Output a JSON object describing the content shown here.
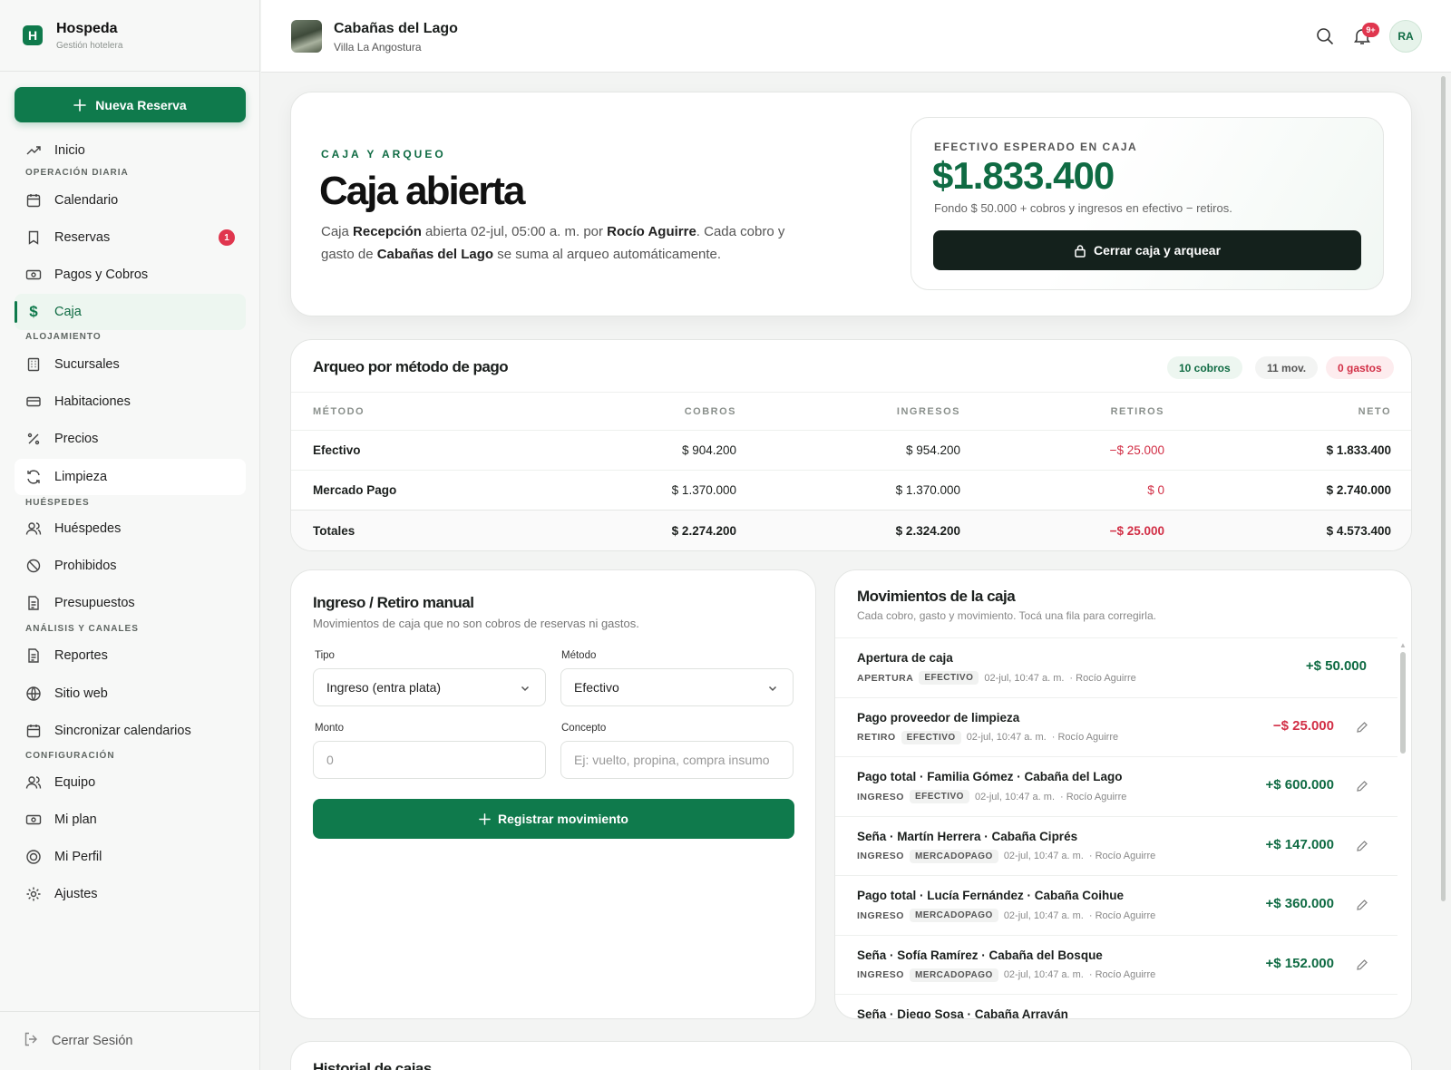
{
  "brand": {
    "name": "Hospeda",
    "subtitle": "Gestión hotelera",
    "logo_letter": "H"
  },
  "sidebar": {
    "new_button": "Nueva Reserva",
    "items": [
      {
        "label": "Inicio",
        "icon": "trend-icon"
      },
      {
        "label": "Calendario",
        "icon": "calendar-icon"
      },
      {
        "label": "Reservas",
        "icon": "bookmark-icon",
        "badge": "1"
      },
      {
        "label": "Pagos y Cobros",
        "icon": "cash-icon"
      },
      {
        "label": "Caja",
        "icon": "dollar-icon",
        "active": true
      },
      {
        "label": "Sucursales",
        "icon": "building-icon"
      },
      {
        "label": "Habitaciones",
        "icon": "bed-icon"
      },
      {
        "label": "Precios",
        "icon": "percent-icon"
      },
      {
        "label": "Limpieza",
        "icon": "refresh-icon"
      },
      {
        "label": "Huéspedes",
        "icon": "users-icon"
      },
      {
        "label": "Prohibidos",
        "icon": "ban-icon"
      },
      {
        "label": "Presupuestos",
        "icon": "file-icon"
      },
      {
        "label": "Reportes",
        "icon": "report-icon"
      },
      {
        "label": "Sitio web",
        "icon": "globe-icon"
      },
      {
        "label": "Sincronizar calendarios",
        "icon": "calendar-sync-icon"
      },
      {
        "label": "Equipo",
        "icon": "team-icon"
      },
      {
        "label": "Mi plan",
        "icon": "plan-icon"
      },
      {
        "label": "Mi Perfil",
        "icon": "profile-icon"
      },
      {
        "label": "Ajustes",
        "icon": "gear-icon"
      }
    ],
    "sections": [
      "OPERACIÓN DIARIA",
      "ALOJAMIENTO",
      "HUÉSPEDES",
      "ANÁLISIS Y CANALES",
      "CONFIGURACIÓN"
    ],
    "logout": "Cerrar Sesión"
  },
  "header": {
    "hotel_name": "Cabañas del Lago",
    "hotel_location": "Villa La Angostura",
    "notifications": "9+",
    "avatar": "RA"
  },
  "hero": {
    "eyebrow": "CAJA Y ARQUEO",
    "title": "Caja abierta",
    "desc_1": "Caja ",
    "desc_station": "Recepción",
    "desc_2": " abierta 02-jul, 05:00 a. m. por ",
    "desc_user": "Rocío Aguirre",
    "desc_3": ". Cada cobro y gasto de ",
    "desc_hotel": "Cabañas del Lago",
    "desc_4": " se suma al arqueo automáticamente.",
    "cash_label": "EFECTIVO ESPERADO EN CAJA",
    "cash_amount": "$1.833.400",
    "cash_sub": "Fondo $ 50.000 + cobros y ingresos en efectivo − retiros.",
    "close_button": "Cerrar caja y arquear"
  },
  "arqueo": {
    "title": "Arqueo por método de pago",
    "pill_cobros": "10 cobros",
    "pill_mov": "11 mov.",
    "pill_gastos": "0 gastos",
    "headers": [
      "MÉTODO",
      "COBROS",
      "INGRESOS",
      "RETIROS",
      "NETO"
    ],
    "rows": [
      [
        "Efectivo",
        "$ 904.200",
        "$ 954.200",
        "−$ 25.000",
        "$ 1.833.400"
      ],
      [
        "Mercado Pago",
        "$ 1.370.000",
        "$ 1.370.000",
        "$ 0",
        "$ 2.740.000"
      ]
    ],
    "totals": [
      "Totales",
      "$ 2.274.200",
      "$ 2.324.200",
      "−$ 25.000",
      "$ 4.573.400"
    ]
  },
  "manual": {
    "title": "Ingreso / Retiro manual",
    "subtitle": "Movimientos de caja que no son cobros de reservas ni gastos.",
    "tipo_label": "Tipo",
    "tipo_value": "Ingreso (entra plata)",
    "metodo_label": "Método",
    "metodo_value": "Efectivo",
    "monto_label": "Monto",
    "monto_placeholder": "0",
    "concepto_label": "Concepto",
    "concepto_placeholder": "Ej: vuelto, propina, compra insumo",
    "submit": "Registrar movimiento"
  },
  "movements": {
    "title": "Movimientos de la caja",
    "subtitle": "Cada cobro, gasto y movimiento. Tocá una fila para corregirla.",
    "items": [
      {
        "name": "Apertura de caja",
        "type": "APERTURA",
        "method": "EFECTIVO",
        "date": "02-jul, 10:47 a. m.",
        "user": "· Rocío Aguirre",
        "amount": "+$ 50.000",
        "sign": "pos",
        "editable": false
      },
      {
        "name": "Pago proveedor de limpieza",
        "type": "RETIRO",
        "method": "EFECTIVO",
        "date": "02-jul, 10:47 a. m.",
        "user": "· Rocío Aguirre",
        "amount": "−$ 25.000",
        "sign": "neg",
        "editable": true
      },
      {
        "name": "Pago total · Familia Gómez · Cabaña del Lago",
        "type": "INGRESO",
        "method": "EFECTIVO",
        "date": "02-jul, 10:47 a. m.",
        "user": "· Rocío Aguirre",
        "amount": "+$ 600.000",
        "sign": "pos",
        "editable": true
      },
      {
        "name": "Seña · Martín Herrera · Cabaña Ciprés",
        "type": "INGRESO",
        "method": "MERCADOPAGO",
        "date": "02-jul, 10:47 a. m.",
        "user": "· Rocío Aguirre",
        "amount": "+$ 147.000",
        "sign": "pos",
        "editable": true
      },
      {
        "name": "Pago total · Lucía Fernández · Cabaña Coihue",
        "type": "INGRESO",
        "method": "MERCADOPAGO",
        "date": "02-jul, 10:47 a. m.",
        "user": "· Rocío Aguirre",
        "amount": "+$ 360.000",
        "sign": "pos",
        "editable": true
      },
      {
        "name": "Seña · Sofía Ramírez · Cabaña del Bosque",
        "type": "INGRESO",
        "method": "MERCADOPAGO",
        "date": "02-jul, 10:47 a. m.",
        "user": "· Rocío Aguirre",
        "amount": "+$ 152.000",
        "sign": "pos",
        "editable": true
      },
      {
        "name": "Seña · Diego Sosa · Cabaña Arrayán",
        "type": "",
        "method": "",
        "date": "",
        "user": "",
        "amount": "",
        "sign": "pos",
        "editable": true
      }
    ]
  },
  "history": {
    "title": "Historial de cajas"
  },
  "colors": {
    "accent": "#0f7a4c",
    "danger": "#d22f46",
    "dark": "#14211c"
  }
}
